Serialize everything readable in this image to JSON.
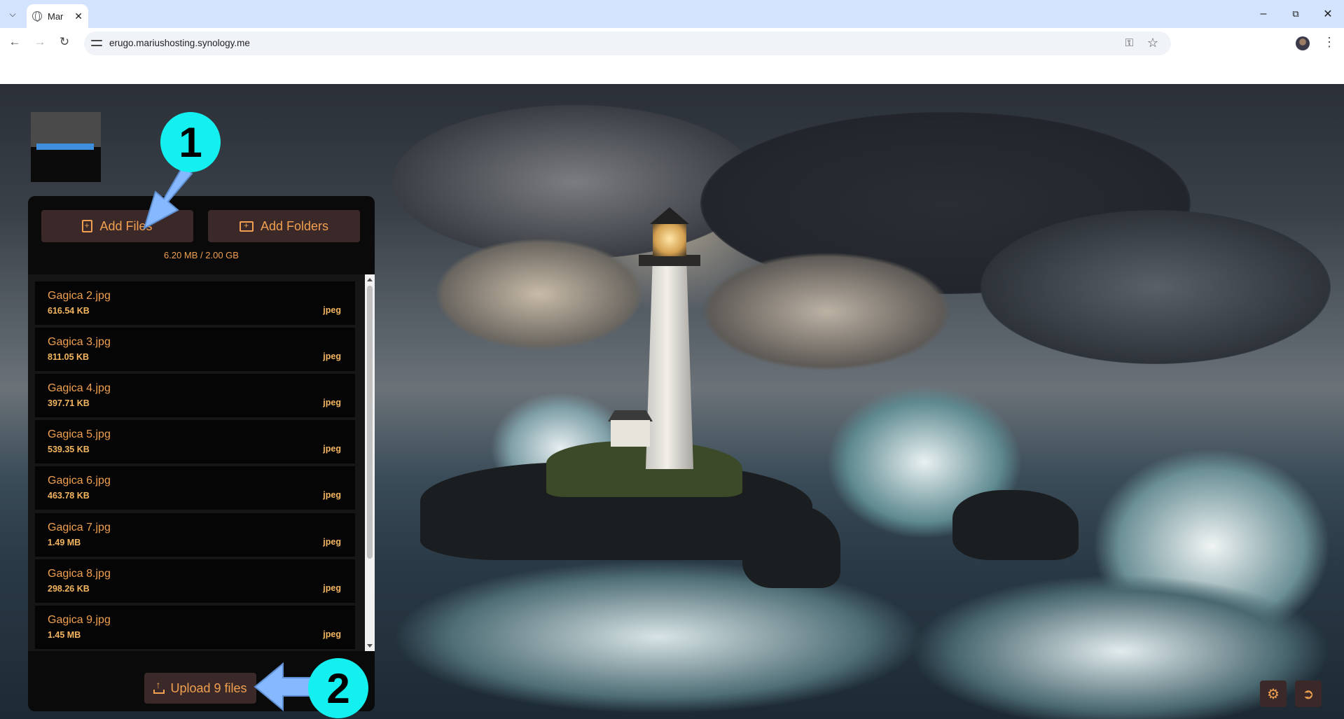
{
  "browser": {
    "tab_title": "Mar",
    "url": "erugo.mariushosting.synology.me",
    "icons": {
      "tab_menu": "chevron-down-icon",
      "tab_favicon": "globe-icon",
      "back": "back-arrow-icon",
      "forward": "forward-arrow-icon",
      "reload": "reload-icon",
      "site_info": "tune-icon",
      "password": "key-icon",
      "bookmark": "star-icon",
      "menu": "kebab-icon"
    }
  },
  "uploader": {
    "add_files_label": "Add Files",
    "add_folders_label": "Add Folders",
    "quota": "6.20 MB / 2.00 GB",
    "files": [
      {
        "name": "Gagica 2.jpg",
        "size": "616.54 KB",
        "type": "jpeg"
      },
      {
        "name": "Gagica 3.jpg",
        "size": "811.05 KB",
        "type": "jpeg"
      },
      {
        "name": "Gagica 4.jpg",
        "size": "397.71 KB",
        "type": "jpeg"
      },
      {
        "name": "Gagica 5.jpg",
        "size": "539.35 KB",
        "type": "jpeg"
      },
      {
        "name": "Gagica 6.jpg",
        "size": "463.78 KB",
        "type": "jpeg"
      },
      {
        "name": "Gagica 7.jpg",
        "size": "1.49 MB",
        "type": "jpeg"
      },
      {
        "name": "Gagica 8.jpg",
        "size": "298.26 KB",
        "type": "jpeg"
      },
      {
        "name": "Gagica 9.jpg",
        "size": "1.45 MB",
        "type": "jpeg"
      }
    ],
    "upload_label": "Upload 9 files"
  },
  "annotations": {
    "step1": "1",
    "step2": "2"
  },
  "colors": {
    "accent": "#f0a050",
    "button_bg": "#3a2928",
    "panel_bg": "#0a0a0a",
    "annotation": "#14f0ef",
    "arrow": "#86b8ff"
  },
  "corner_icons": [
    "gear-icon",
    "logout-icon"
  ]
}
